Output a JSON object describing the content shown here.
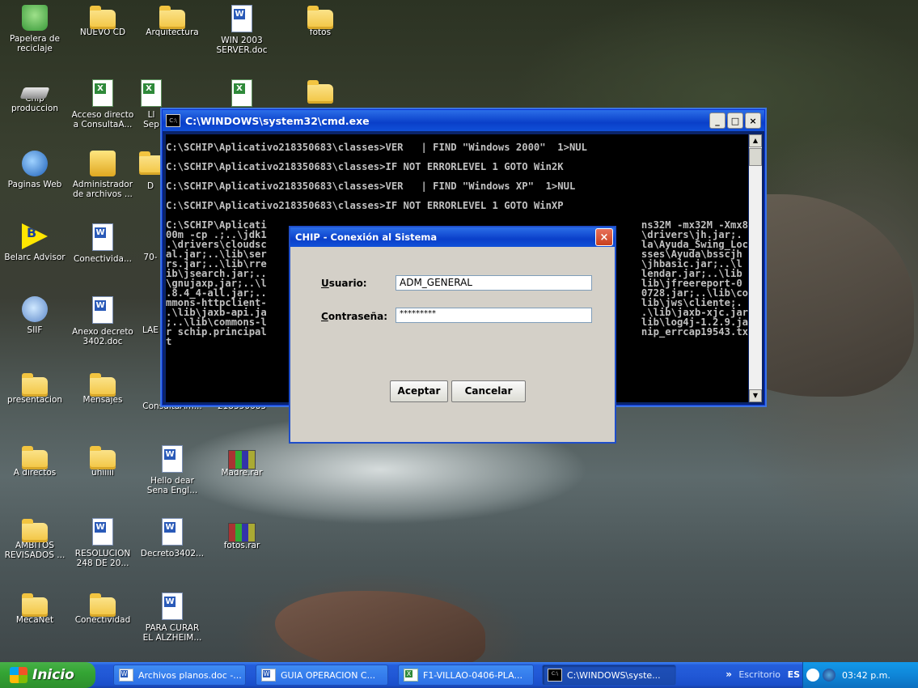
{
  "desktop_icons": [
    {
      "label": "Papelera de reciclaje",
      "icon": "recycle-bin-icon"
    },
    {
      "label": "NUEVO CD",
      "icon": "folder-icon"
    },
    {
      "label": "Arquitectura",
      "icon": "folder-icon"
    },
    {
      "label": "WIN 2003 SERVER.doc",
      "icon": "word-document-icon"
    },
    {
      "label": "fotos",
      "icon": "folder-icon"
    },
    {
      "label": "Chip produccion",
      "icon": "chip-icon"
    },
    {
      "label": "Acceso directo a ConsultaA...",
      "icon": "excel-document-icon"
    },
    {
      "label": "Ll Sep",
      "icon": "excel-document-icon"
    },
    {
      "label": "",
      "icon": "excel-document-icon"
    },
    {
      "label": "",
      "icon": "folder-icon"
    },
    {
      "label": "Paginas Web",
      "icon": "globe-icon"
    },
    {
      "label": "Administrador de archivos ...",
      "icon": "file-manager-icon"
    },
    {
      "label": "D",
      "icon": "folder-icon"
    },
    {
      "label": "Belarc Advisor",
      "icon": "belarc-icon"
    },
    {
      "label": "Conectivida...",
      "icon": "word-document-icon"
    },
    {
      "label": "70-",
      "icon": "word-document-icon"
    },
    {
      "label": "SIIF",
      "icon": "siif-icon"
    },
    {
      "label": "Anexo decreto 3402.doc",
      "icon": "word-document-icon"
    },
    {
      "label": "LAE",
      "icon": "word-document-icon"
    },
    {
      "label": "presentacion",
      "icon": "folder-icon"
    },
    {
      "label": "Mensajes",
      "icon": "folder-icon"
    },
    {
      "label": "ConsultaAm...",
      "icon": "excel-document-icon"
    },
    {
      "label": "218350683",
      "icon": "folder-icon"
    },
    {
      "label": "A directos",
      "icon": "folder-icon"
    },
    {
      "label": "uhiiiii",
      "icon": "folder-icon"
    },
    {
      "label": "Hello dear Sena Engl...",
      "icon": "word-document-icon"
    },
    {
      "label": "Madre.rar",
      "icon": "rar-archive-icon"
    },
    {
      "label": "AMBITOS REVISADOS ...",
      "icon": "folder-icon"
    },
    {
      "label": "RESOLUCION 248 DE 20...",
      "icon": "word-document-icon"
    },
    {
      "label": "Decreto3402...",
      "icon": "word-document-icon"
    },
    {
      "label": "fotos.rar",
      "icon": "rar-archive-icon"
    },
    {
      "label": "MecaNet",
      "icon": "folder-icon"
    },
    {
      "label": "Conectividad",
      "icon": "folder-icon"
    },
    {
      "label": "PARA CURAR EL ALZHEIM...",
      "icon": "word-document-icon"
    }
  ],
  "cmd_window": {
    "title": "C:\\WINDOWS\\system32\\cmd.exe",
    "icon_text": "C:\\",
    "buttons": {
      "minimize": "_",
      "maximize": "□",
      "close": "×"
    },
    "lines_top": [
      "C:\\SCHIP\\Aplicativo218350683\\classes>VER   | FIND \"Windows 2000\"  1>NUL",
      "",
      "C:\\SCHIP\\Aplicativo218350683\\classes>IF NOT ERRORLEVEL 1 GOTO Win2K",
      "",
      "C:\\SCHIP\\Aplicativo218350683\\classes>VER   | FIND \"Windows XP\"  1>NUL",
      "",
      "C:\\SCHIP\\Aplicativo218350683\\classes>IF NOT ERRORLEVEL 1 GOTO WinXP",
      ""
    ],
    "lines_left": [
      "C:\\SCHIP\\Aplicati",
      "00m -cp .;..\\jdk1",
      ".\\drivers\\cloudsc",
      "al.jar;..\\lib\\ser",
      "rs.jar;..\\lib\\rre",
      "ib\\jsearch.jar;..",
      "\\gnujaxp.jar;..\\l",
      ".8.4_4-all.jar;..",
      "mmons-httpclient-",
      ".\\lib\\jaxb-api.ja",
      ";..\\lib\\commons-l",
      "r schip.principal",
      "t"
    ],
    "lines_right": [
      "ns32M -mx32M -Xmx8",
      "\\drivers\\jh.jar;.",
      "la\\Ayuda_Swing_Loc",
      "sses\\Ayuda\\bsscjh",
      "\\jhbasic.jar;..\\l",
      "lendar.jar;..\\lib",
      "lib\\jfreereport-0",
      "0728.jar;..\\lib\\co",
      "lib\\jws\\cliente;.",
      ".\\lib\\jaxb-xjc.jar",
      "lib\\log4j-1.2.9.ja",
      "nip_errcap19543.tx",
      ""
    ]
  },
  "login_dialog": {
    "title": "CHIP - Conexión al Sistema",
    "close_symbol": "×",
    "usuario_label_key": "U",
    "usuario_label_rest": "suario:",
    "usuario_value": "ADM_GENERAL",
    "password_label_key": "C",
    "password_label_rest": "ontraseña:",
    "password_value": "*********",
    "accept_label": "Aceptar",
    "cancel_label": "Cancelar"
  },
  "taskbar": {
    "start_label": "Inicio",
    "tasks": [
      {
        "label": "Archivos planos.doc -...",
        "icon": "word"
      },
      {
        "label": "GUIA OPERACION C...",
        "icon": "word"
      },
      {
        "label": "F1-VILLAO-0406-PLA...",
        "icon": "excel"
      },
      {
        "label": "C:\\WINDOWS\\syste...",
        "icon": "cmd"
      }
    ],
    "chevron": "»",
    "toolbar_label": "Escritorio",
    "language": "ES",
    "time": "03:42 p.m."
  },
  "colors": {
    "taskbar_blue": "#245edb",
    "start_green": "#34a534",
    "title_blue": "#0a3fc9",
    "dialog_gray": "#d4d0c8",
    "cmd_text": "#c0c0c0"
  }
}
